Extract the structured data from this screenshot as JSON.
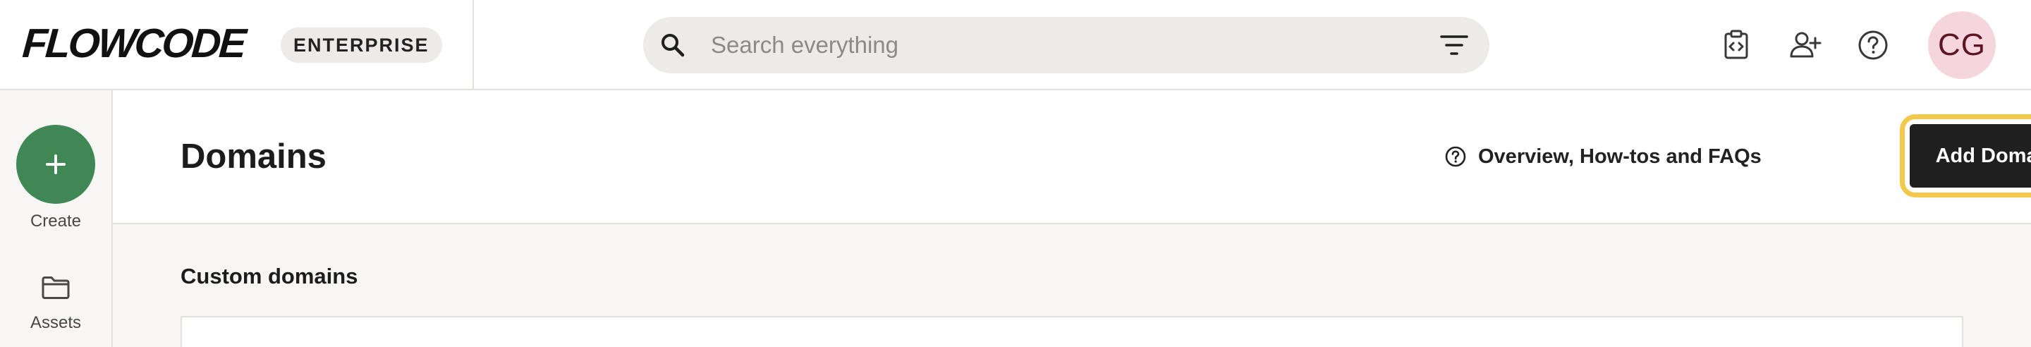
{
  "brand": {
    "logo_text": "FLOWCODE",
    "plan_badge": "ENTERPRISE"
  },
  "search": {
    "placeholder": "Search everything",
    "value": ""
  },
  "header_icons": [
    "code-clipboard-icon",
    "add-user-icon",
    "help-circle-icon"
  ],
  "user": {
    "initials": "CG",
    "avatar_bg": "#f6d6de",
    "avatar_fg": "#5e1423"
  },
  "sidebar": {
    "items": [
      {
        "label": "Create",
        "icon": "plus-icon"
      },
      {
        "label": "Assets",
        "icon": "folder-icon"
      }
    ]
  },
  "page": {
    "title": "Domains",
    "help_link": "Overview, How-tos and FAQs",
    "primary_action": "Add Domain"
  },
  "section": {
    "title": "Custom domains"
  },
  "colors": {
    "accent_green": "#3f8856",
    "primary_button": "#1f1f1f",
    "highlight": "#f2c94c",
    "surface_muted": "#f7f6f4"
  }
}
